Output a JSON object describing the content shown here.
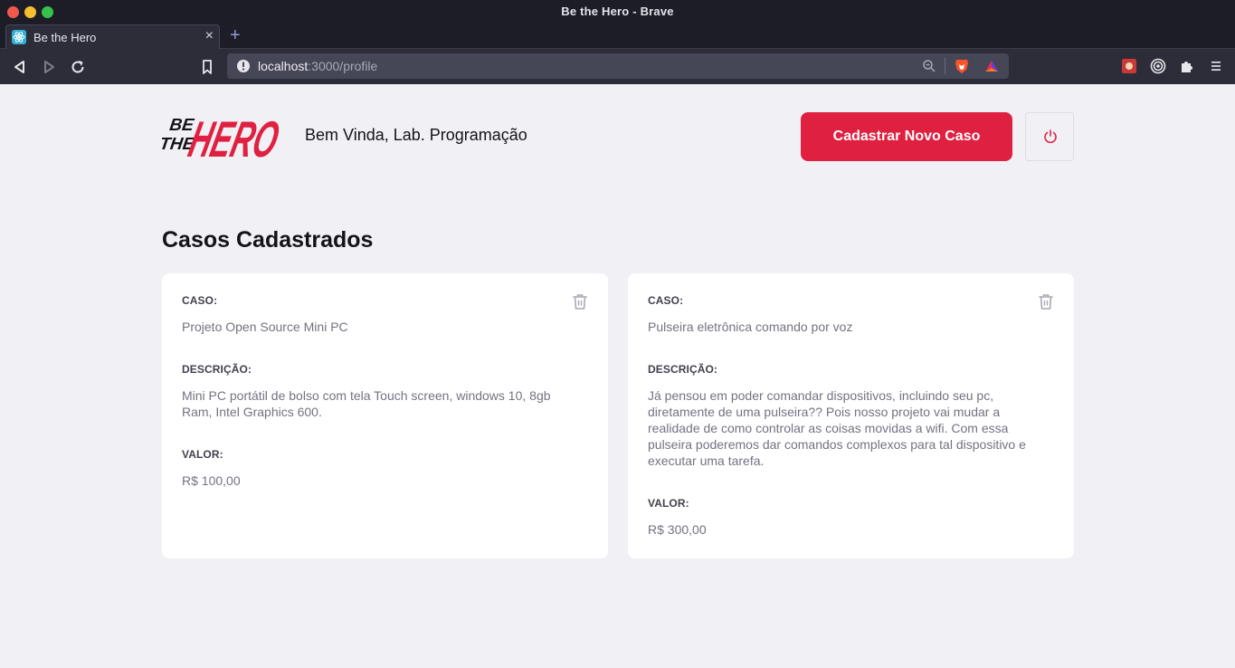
{
  "window": {
    "title": "Be the Hero - Brave"
  },
  "tab": {
    "title": "Be the Hero",
    "close": "×",
    "new_tab": "+"
  },
  "url": {
    "host": "localhost",
    "rest": ":3000/profile"
  },
  "header": {
    "logo_text": {
      "line1": "BE",
      "line2": "THE",
      "word": "HERO"
    },
    "welcome": "Bem Vinda, Lab. Programação",
    "new_case_button": "Cadastrar Novo Caso"
  },
  "section_title": "Casos Cadastrados",
  "incidents": [
    {
      "case_label": "CASO:",
      "case": "Projeto Open Source Mini PC",
      "desc_label": "DESCRIÇÃO:",
      "description": "Mini PC portátil de bolso com tela Touch screen, windows 10, 8gb Ram, Intel Graphics 600.",
      "value_label": "VALOR:",
      "value": "R$ 100,00"
    },
    {
      "case_label": "CASO:",
      "case": "Pulseira eletrônica comando por voz",
      "desc_label": "DESCRIÇÃO:",
      "description": "Já pensou em poder comandar dispositivos, incluindo seu pc, diretamente de uma pulseira?? Pois nosso projeto vai mudar a realidade de como controlar as coisas movidas a wifi. Com essa pulseira poderemos dar comandos complexos para tal dispositivo e executar uma tarefa.",
      "value_label": "VALOR:",
      "value": "R$ 300,00"
    }
  ],
  "colors": {
    "primary": "#e02041",
    "background": "#f0f0f5",
    "text": "#13131a",
    "muted": "#737380"
  }
}
